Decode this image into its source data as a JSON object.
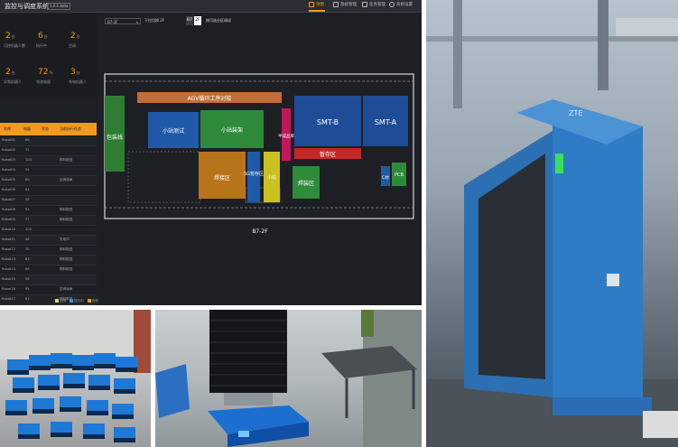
{
  "screen": {
    "app_title": "监控与调度系统",
    "version": "1.0.1.beta",
    "nav": [
      {
        "label": "地图",
        "active": true
      },
      {
        "label": "系统管理",
        "active": false
      },
      {
        "label": "任务管理",
        "active": false
      },
      {
        "label": "系统设置",
        "active": false
      }
    ],
    "stats": [
      {
        "value": "2",
        "unit": "台",
        "label": "可控机器人数"
      },
      {
        "value": "6",
        "unit": "台",
        "label": "执行中"
      },
      {
        "value": "2",
        "unit": "台",
        "label": "空闲"
      },
      {
        "value": "2",
        "unit": "台",
        "label": "异常机器人"
      },
      {
        "value": "72",
        "unit": "%",
        "label": "电池电量"
      },
      {
        "value": "3",
        "unit": "台",
        "label": "充电机器人"
      }
    ],
    "table": {
      "headers": [
        "名称",
        "电量",
        "状态",
        "当前执行任务"
      ],
      "rows": [
        {
          "name": "Robot01",
          "battery": "68",
          "status": "",
          "task": ""
        },
        {
          "name": "Robot02",
          "battery": "72",
          "status": "",
          "task": ""
        },
        {
          "name": "Robot03",
          "battery": "100",
          "status": "",
          "task": "物料配送"
        },
        {
          "name": "Robot04",
          "battery": "55",
          "status": "",
          "task": ""
        },
        {
          "name": "Robot05",
          "battery": "80",
          "status": "",
          "task": "空闲待命"
        },
        {
          "name": "Robot06",
          "battery": "64",
          "status": "",
          "task": ""
        },
        {
          "name": "Robot07",
          "battery": "59",
          "status": "",
          "task": ""
        },
        {
          "name": "Robot08",
          "battery": "91",
          "status": "",
          "task": "物料配送"
        },
        {
          "name": "Robot09",
          "battery": "77",
          "status": "",
          "task": "物料配送"
        },
        {
          "name": "Robot10",
          "battery": "100",
          "status": "",
          "task": ""
        },
        {
          "name": "Robot11",
          "battery": "46",
          "status": "",
          "task": "充电中"
        },
        {
          "name": "Robot12",
          "battery": "70",
          "status": "",
          "task": "物料配送"
        },
        {
          "name": "Robot13",
          "battery": "83",
          "status": "",
          "task": "物料配送"
        },
        {
          "name": "Robot14",
          "battery": "66",
          "status": "",
          "task": "物料配送"
        },
        {
          "name": "Robot15",
          "battery": "58",
          "status": "",
          "task": ""
        },
        {
          "name": "Robot16",
          "battery": "95",
          "status": "",
          "task": "空闲待命"
        },
        {
          "name": "Robot17",
          "battery": "61",
          "status": "",
          "task": "物料配送"
        }
      ]
    },
    "legend": [
      "空闲",
      "执行中",
      "充电"
    ],
    "legend_colors": [
      "#c8e07a",
      "#3a8fe0",
      "#f39a1e"
    ],
    "map_toolbar": {
      "dropdown": "B7-2F",
      "page_input": "下拉切换  2F",
      "floors": [
        "B7",
        "2F"
      ],
      "floor_label": "按可选分区调试"
    },
    "map": {
      "floor_label": "B7-2F",
      "zones": {
        "agv": "AGV循环工序对接",
        "packaging": "包装线",
        "test": "小站测试",
        "assembly": "小站装架",
        "welding": "焊接区",
        "fiveg": "5G暂存区",
        "small": "小站",
        "welding2": "焊装区",
        "semi": "半成品库",
        "smtb": "SMT-B",
        "smta": "SMT-A",
        "staging": "暂存区",
        "c_mat": "C材",
        "pcb": "PCB"
      }
    }
  },
  "photos": {
    "container_brand": "ZTE"
  }
}
